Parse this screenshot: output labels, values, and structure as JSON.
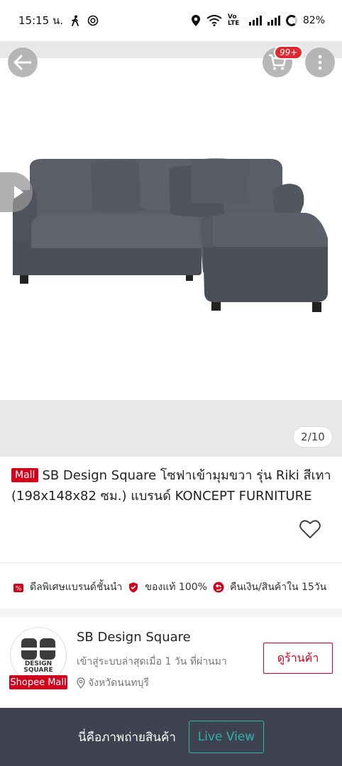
{
  "status_bar": {
    "time": "15:15 น.",
    "network_label": "Vo LTE",
    "battery": "82%"
  },
  "gallery": {
    "cart_badge": "99+",
    "page_indicator": "2/10"
  },
  "product": {
    "mall_badge": "Mall",
    "title": "SB Design Square โซฟาเข้ามุมขวา รุ่น Riki สีเทา (198x148x82 ซม.)  แบรนด์ KONCEPT FURNITURE"
  },
  "guarantees": [
    {
      "label": "ดีลพิเศษแบรนด์ชั้นนำ",
      "icon": "percent-tag-icon"
    },
    {
      "label": "ของแท้ 100%",
      "icon": "shield-check-icon"
    },
    {
      "label": "คืนเงิน/สินค้าใน 15วัน",
      "icon": "return-icon"
    }
  ],
  "shop": {
    "logo_line1": "DESIGN",
    "logo_line2": "SQUARE",
    "mall_badge": "Shopee Mall",
    "name": "SB Design Square",
    "active_status": "เข้าสู่ระบบล่าสุดเมื่อ 1 วัน ที่ผ่านมา",
    "location": "จังหวัดนนทบุรี",
    "view_shop_label": "ดูร้านค้า"
  },
  "bottom_bar": {
    "text": "นี่คือภาพถ่ายสินค้า",
    "live_view_label": "Live View"
  },
  "colors": {
    "brand_red": "#d0011b",
    "live_teal": "#2bb3a6",
    "bottom_bar_bg": "#3f4250"
  }
}
